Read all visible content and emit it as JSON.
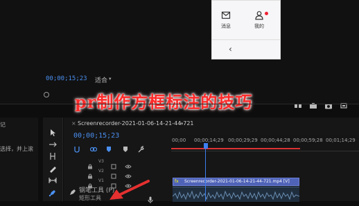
{
  "phone_popup": {
    "tabs": [
      {
        "label": "消息",
        "icon": "message-icon"
      },
      {
        "label": "我的",
        "icon": "user-icon"
      }
    ],
    "back_icon": "‹"
  },
  "program_monitor": {
    "timecode": "00;00;15;23",
    "fit_label": "适合",
    "fit_caret": "▾"
  },
  "overlay_title": "pr制作方框标注的技巧",
  "left_panel": {
    "label1": "记",
    "label2": "选择，并上滚"
  },
  "timeline": {
    "sequence_name": "Screenrecorder-2021-01-06-14-21-44-721",
    "close_glyph": "×",
    "menu_glyph": "≡",
    "timecode": "00;00;15;23",
    "ruler_labels": [
      "00;00",
      "00;00;14;29",
      "00;00;29;29",
      "00;00;44;28",
      "00;00;59;28",
      "00;01;14;29"
    ],
    "tracks": [
      {
        "name": "V3"
      },
      {
        "name": "V2"
      },
      {
        "name": "V1"
      }
    ],
    "video_clip": {
      "fx": "fx",
      "label": "Screenrecorder-2021-01-06-14-21-44-721.mp4 [V]"
    }
  },
  "tooltip": {
    "line1": "钢笔工具 (P)",
    "line2": "矩形工具"
  },
  "colors": {
    "accent_blue": "#4a8ff0",
    "title_red": "#ff2b2b",
    "clip_blue": "#4f63b8",
    "work_area_red": "#dd3333"
  }
}
